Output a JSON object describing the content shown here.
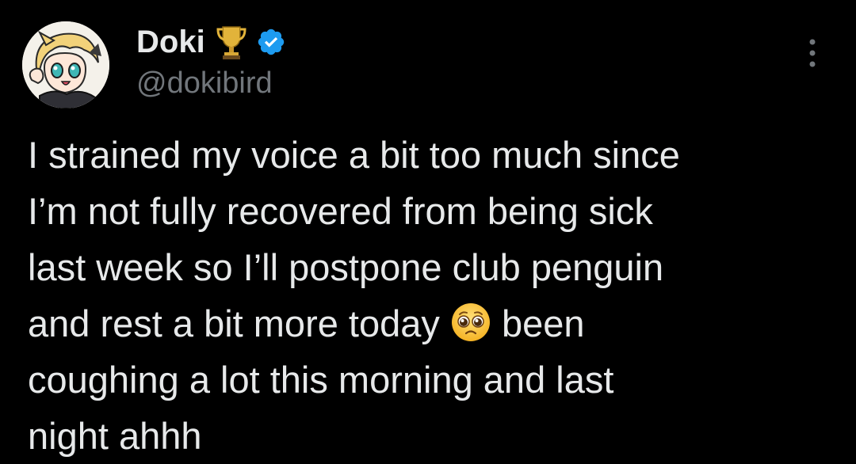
{
  "tweet": {
    "author": {
      "display_name": "Doki",
      "handle": "@dokibird",
      "badge_icon": "trophy-icon",
      "verified_icon": "verified-badge-icon",
      "verified_color": "#1d9bf0"
    },
    "text_before_emoji": "I strained my voice a bit too much since\nI’m not fully recovered from being sick\nlast week so I’ll postpone club penguin\nand rest a bit more today ",
    "emoji": "pleading-face-emoji",
    "text_after_emoji": " been\ncoughing a lot this morning and last\nnight ahhh",
    "menu_icon": "more-options-icon"
  },
  "colors": {
    "background": "#000000",
    "primary_text": "#e7e9ea",
    "secondary_text": "#71767b"
  }
}
